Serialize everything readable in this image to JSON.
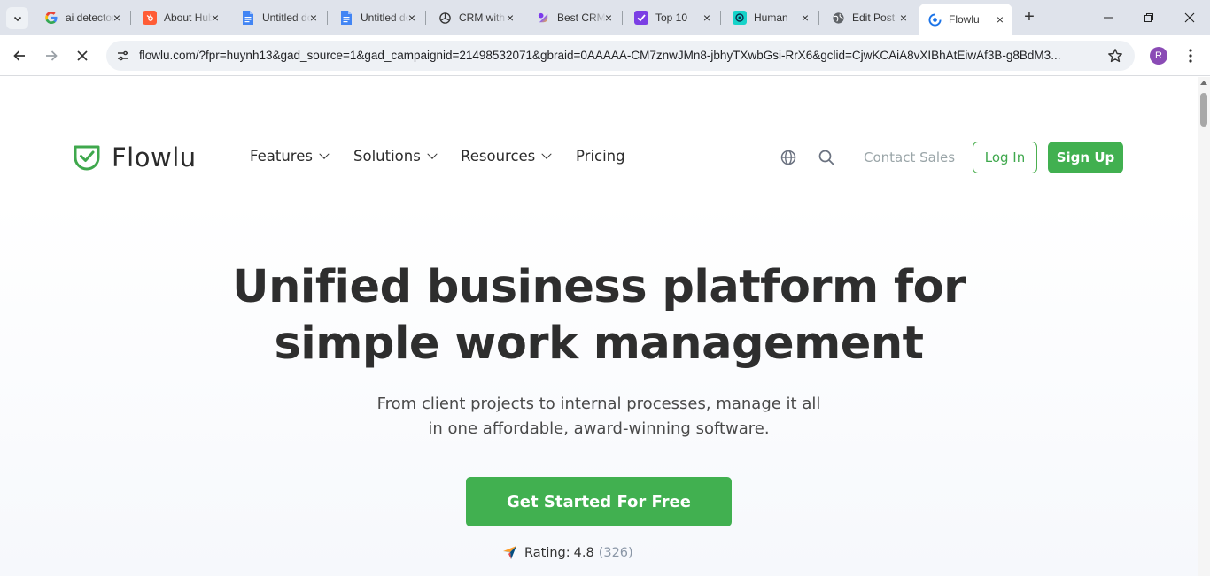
{
  "browser": {
    "tabs": [
      {
        "title": "ai detector",
        "icon": "google-icon"
      },
      {
        "title": "About HubSpot",
        "icon": "hubspot-icon"
      },
      {
        "title": "Untitled document",
        "icon": "google-docs-icon"
      },
      {
        "title": "Untitled document",
        "icon": "google-docs-icon"
      },
      {
        "title": "CRM with",
        "icon": "chatgpt-icon"
      },
      {
        "title": "Best CRM",
        "icon": "clickup-icon"
      },
      {
        "title": "Top 10",
        "icon": "checkmark-app-icon"
      },
      {
        "title": "Human",
        "icon": "humanizer-icon"
      },
      {
        "title": "Edit Post",
        "icon": "globe-icon"
      },
      {
        "title": "Flowlu",
        "icon": "flowlu-icon",
        "active": true
      }
    ],
    "close_glyph": "×",
    "new_tab_glyph": "+",
    "url": "flowlu.com/?fpr=huynh13&gad_source=1&gad_campaignid=21498532071&gbraid=0AAAAA-CM7znwJMn8-jbhyTXwbGsi-RrX6&gclid=CjwKCAiA8vXIBhAtEiwAf3B-g8BdM3...",
    "profile_initial": "R"
  },
  "site": {
    "logo_text": "Flowlu",
    "nav": {
      "features": "Features",
      "solutions": "Solutions",
      "resources": "Resources",
      "pricing": "Pricing"
    },
    "contact_sales": "Contact Sales",
    "login": "Log In",
    "signup": "Sign Up",
    "headline_line1": "Unified business platform for",
    "headline_line2": "simple work management",
    "sub_line1": "From client projects to internal processes, manage it all",
    "sub_line2": "in one affordable, award-winning software.",
    "cta": "Get Started For Free",
    "rating_label": "Rating:",
    "rating_value": "4.8",
    "rating_count": "(326)"
  },
  "colors": {
    "brand_green": "#41b050",
    "tab_strip": "#dfe3eb",
    "headline": "#2e2e2e"
  }
}
